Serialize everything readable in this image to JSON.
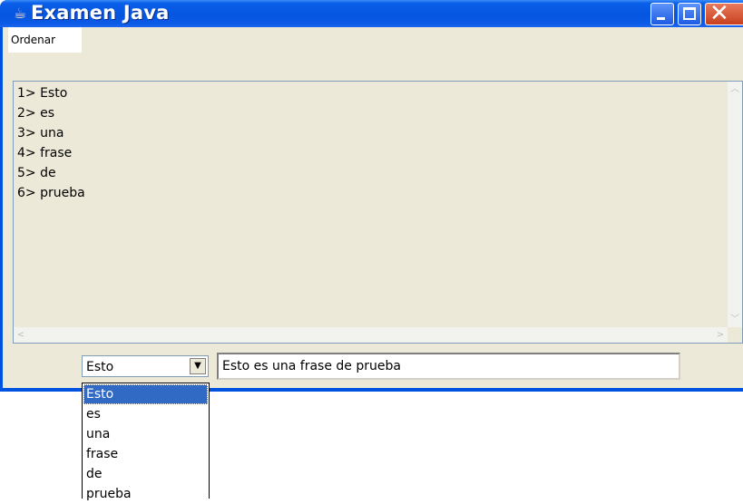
{
  "window": {
    "title": "Examen Java",
    "app_icon": "java-cup-icon",
    "controls": [
      "minimize-icon",
      "maximize-icon",
      "close-icon"
    ]
  },
  "menu": {
    "items": [
      {
        "label": "Ordenar"
      }
    ]
  },
  "textarea": {
    "lines": [
      "1> Esto",
      "2> es",
      "3> una",
      "4> frase",
      "5> de",
      "6> prueba"
    ]
  },
  "combo": {
    "selected": "Esto",
    "options": [
      "Esto",
      "es",
      "una",
      "frase",
      "de",
      "prueba"
    ]
  },
  "field": {
    "value": "Esto es una frase de prueba"
  },
  "colors": {
    "title_bar": "#0555e0",
    "client_bg": "#ece9d8",
    "selection": "#316ac5"
  }
}
